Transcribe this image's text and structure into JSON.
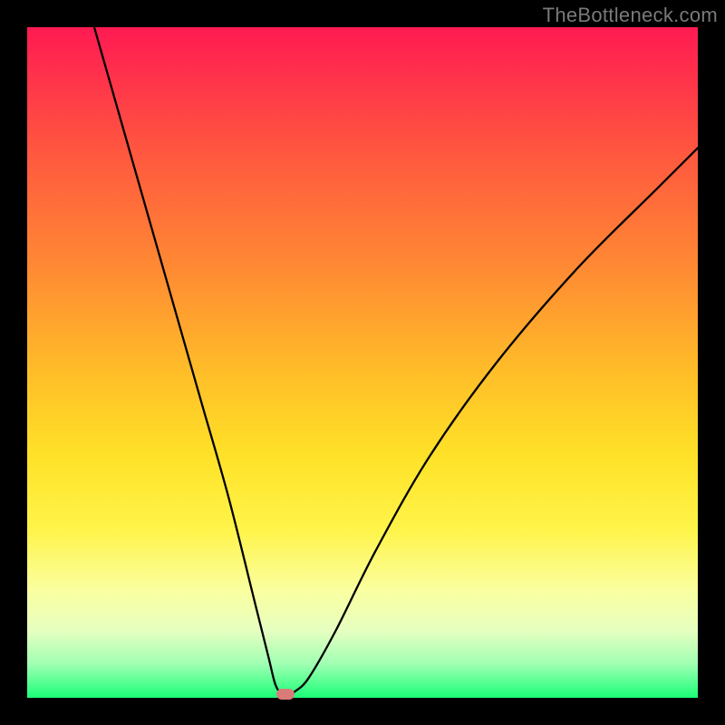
{
  "watermark": "TheBottleneck.com",
  "chart_data": {
    "type": "line",
    "title": "",
    "xlabel": "",
    "ylabel": "",
    "xlim": [
      0,
      100
    ],
    "ylim": [
      0,
      100
    ],
    "series": [
      {
        "name": "bottleneck-curve",
        "x": [
          10,
          14,
          18,
          22,
          26,
          30,
          34,
          36,
          37,
          38,
          39,
          40,
          42,
          46,
          52,
          60,
          70,
          82,
          94,
          100
        ],
        "y": [
          100,
          86,
          72,
          58,
          44,
          30,
          14,
          6,
          2,
          0.5,
          0.5,
          1,
          3,
          10,
          22,
          36,
          50,
          64,
          76,
          82
        ]
      }
    ],
    "marker": {
      "x": 38.5,
      "y": 0.5
    },
    "gradient_stops": [
      {
        "pos": 0,
        "color": "#ff1a52"
      },
      {
        "pos": 18,
        "color": "#ff5540"
      },
      {
        "pos": 36,
        "color": "#ff8a33"
      },
      {
        "pos": 52,
        "color": "#ffbf28"
      },
      {
        "pos": 64,
        "color": "#ffe228"
      },
      {
        "pos": 75,
        "color": "#fff44a"
      },
      {
        "pos": 84,
        "color": "#faffa0"
      },
      {
        "pos": 90,
        "color": "#e6ffc0"
      },
      {
        "pos": 95,
        "color": "#9fffb3"
      },
      {
        "pos": 100,
        "color": "#1aff77"
      }
    ]
  }
}
